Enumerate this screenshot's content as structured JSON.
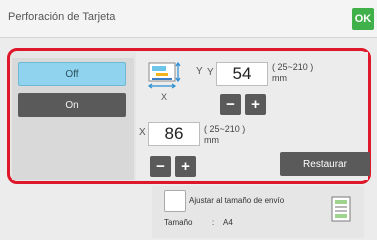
{
  "header": {
    "title": "Perforación de Tarjeta",
    "ok_label": "OK"
  },
  "mode": {
    "off_label": "Off",
    "on_label": "On",
    "selected": "Off"
  },
  "y_setting": {
    "axis": "Y",
    "value": "54",
    "range": "( 25~210 )",
    "unit": "mm"
  },
  "x_setting": {
    "axis": "X",
    "value": "86",
    "range": "( 25~210 )",
    "unit": "mm"
  },
  "paper_icon_axis_y": "Y",
  "paper_icon_axis_x": "X",
  "stepper": {
    "minus": "−",
    "plus": "+"
  },
  "restore_label": "Restaurar",
  "fit": {
    "label": "Ajustar al tamaño de envío",
    "size_label": "Tamaño",
    "size_colon": ":",
    "size_value": "A4"
  },
  "colors": {
    "accent_ok": "#3fb04a",
    "highlight_border": "#e0162b",
    "selected_button": "#8fd3ef",
    "dark_button": "#5a5a5a"
  }
}
